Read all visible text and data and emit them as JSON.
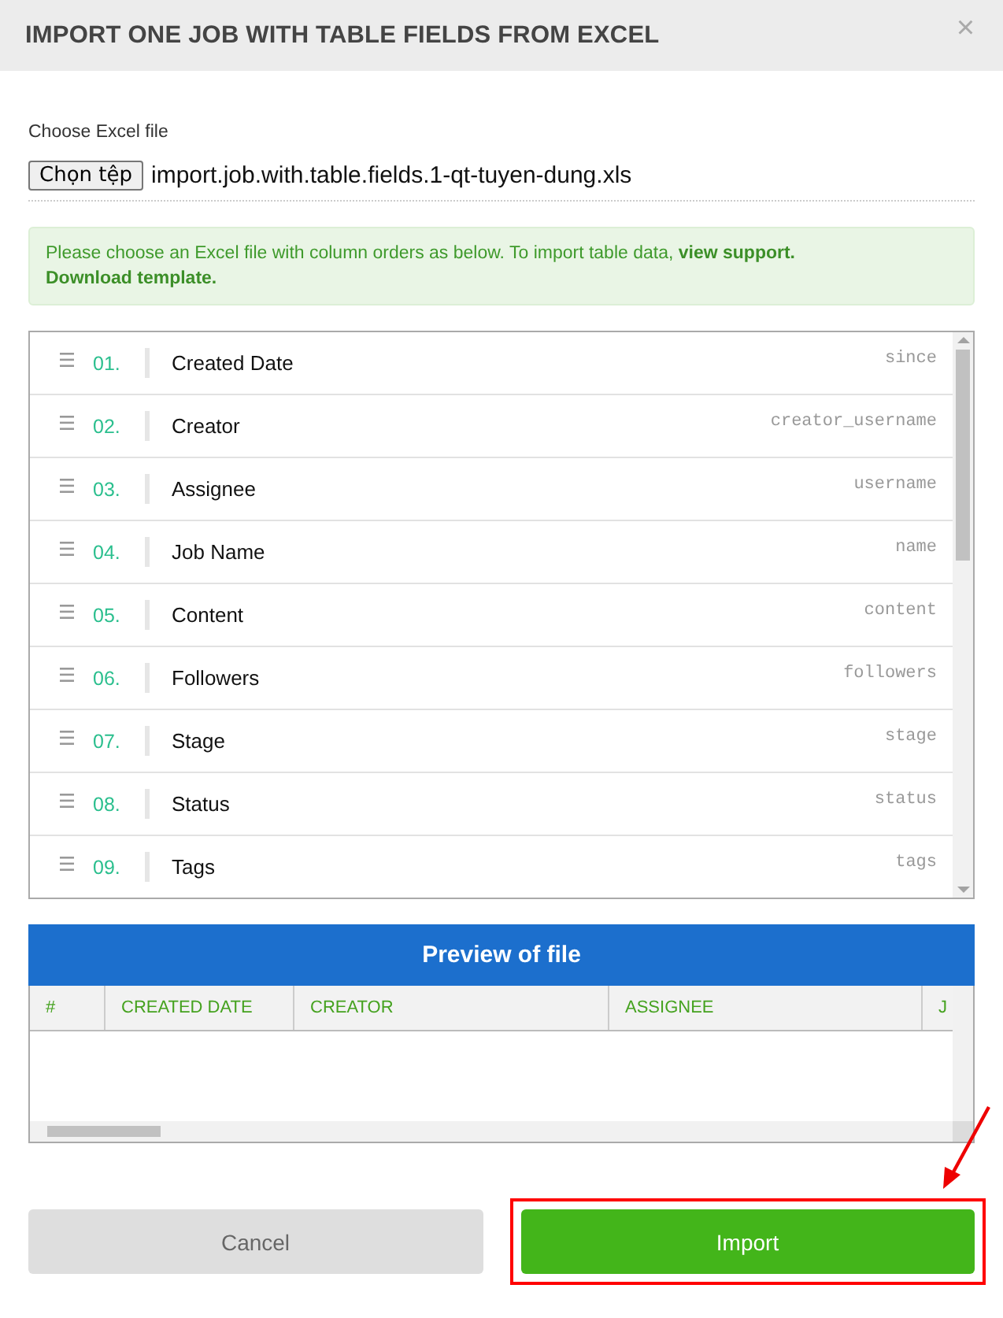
{
  "dialog": {
    "title": "IMPORT ONE JOB WITH TABLE FIELDS FROM EXCEL",
    "close": "×"
  },
  "file": {
    "label": "Choose Excel file",
    "button": "Chọn tệp",
    "filename": "import.job.with.table.fields.1-qt-tuyen-dung.xls"
  },
  "notice": [
    {
      "kind": "text",
      "text": "Please choose an Excel file with column orders as below. To import table data, "
    },
    {
      "kind": "link",
      "text": "view support."
    },
    {
      "kind": "link",
      "text": "Download template."
    }
  ],
  "fields": [
    {
      "number": "01.",
      "label": "Created Date",
      "key": "since"
    },
    {
      "number": "02.",
      "label": "Creator",
      "key": "creator_username"
    },
    {
      "number": "03.",
      "label": "Assignee",
      "key": "username"
    },
    {
      "number": "04.",
      "label": "Job Name",
      "key": "name"
    },
    {
      "number": "05.",
      "label": "Content",
      "key": "content"
    },
    {
      "number": "06.",
      "label": "Followers",
      "key": "followers"
    },
    {
      "number": "07.",
      "label": "Stage",
      "key": "stage"
    },
    {
      "number": "08.",
      "label": "Status",
      "key": "status"
    },
    {
      "number": "09.",
      "label": "Tags",
      "key": "tags"
    }
  ],
  "preview": {
    "title": "Preview of file",
    "columns": [
      "#",
      "CREATED DATE",
      "CREATOR",
      "ASSIGNEE",
      "J"
    ]
  },
  "buttons": [
    {
      "label": "Cancel",
      "kind": "secondary",
      "highlighted": false
    },
    {
      "label": "Import",
      "kind": "primary",
      "highlighted": true
    }
  ]
}
